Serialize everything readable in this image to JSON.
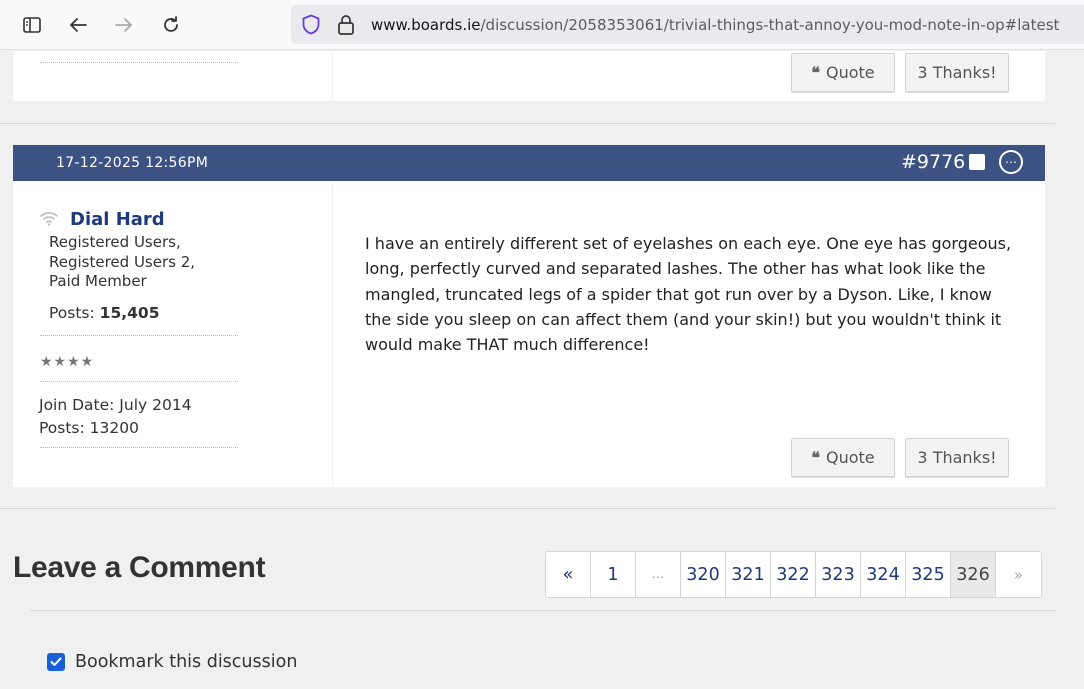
{
  "browser": {
    "url_host": "www.boards.ie",
    "url_path": "/discussion/2058353061/trivial-things-that-annoy-you-mod-note-in-op#latest",
    "icons": [
      "sidebar-icon",
      "back-icon",
      "forward-icon",
      "reload-icon",
      "shield-icon",
      "lock-icon"
    ]
  },
  "previous_post": {
    "quote_label": "Quote",
    "thanks_label": "3 Thanks!"
  },
  "post": {
    "date": "17-12-2025 12:56PM",
    "number": "#9776",
    "author": {
      "name": "Dial Hard",
      "groups": [
        "Registered Users,",
        "Registered Users 2,",
        "Paid Member"
      ],
      "posts_label": "Posts:",
      "posts_value": "15,405",
      "stars": "★★★★",
      "join_date": "Join Date: July 2014",
      "posts_count_line": "Posts: 13200"
    },
    "body": "I have an entirely different set of eyelashes on each eye. One eye has gorgeous, long, perfectly curved and separated lashes. The other has what look like the mangled, truncated legs of a spider that got run over by a Dyson. Like, I know the side you sleep on can affect them (and your skin!) but you wouldn't think it would make THAT much difference!",
    "quote_label": "Quote",
    "thanks_label": "3 Thanks!"
  },
  "comment": {
    "title": "Leave a Comment",
    "bookmark_label": "Bookmark this discussion",
    "bookmark_checked": true
  },
  "pagination": {
    "items": [
      {
        "label": "«",
        "kind": "nav"
      },
      {
        "label": "1",
        "kind": "page"
      },
      {
        "label": "…",
        "kind": "ellipsis"
      },
      {
        "label": "320",
        "kind": "page"
      },
      {
        "label": "321",
        "kind": "page"
      },
      {
        "label": "322",
        "kind": "page"
      },
      {
        "label": "323",
        "kind": "page"
      },
      {
        "label": "324",
        "kind": "page"
      },
      {
        "label": "325",
        "kind": "page"
      },
      {
        "label": "326",
        "kind": "active"
      },
      {
        "label": "»",
        "kind": "disabled"
      }
    ]
  },
  "colors": {
    "header_bg": "#3c5283",
    "link": "#1f3a7a",
    "checkbox": "#1a5fd8"
  }
}
